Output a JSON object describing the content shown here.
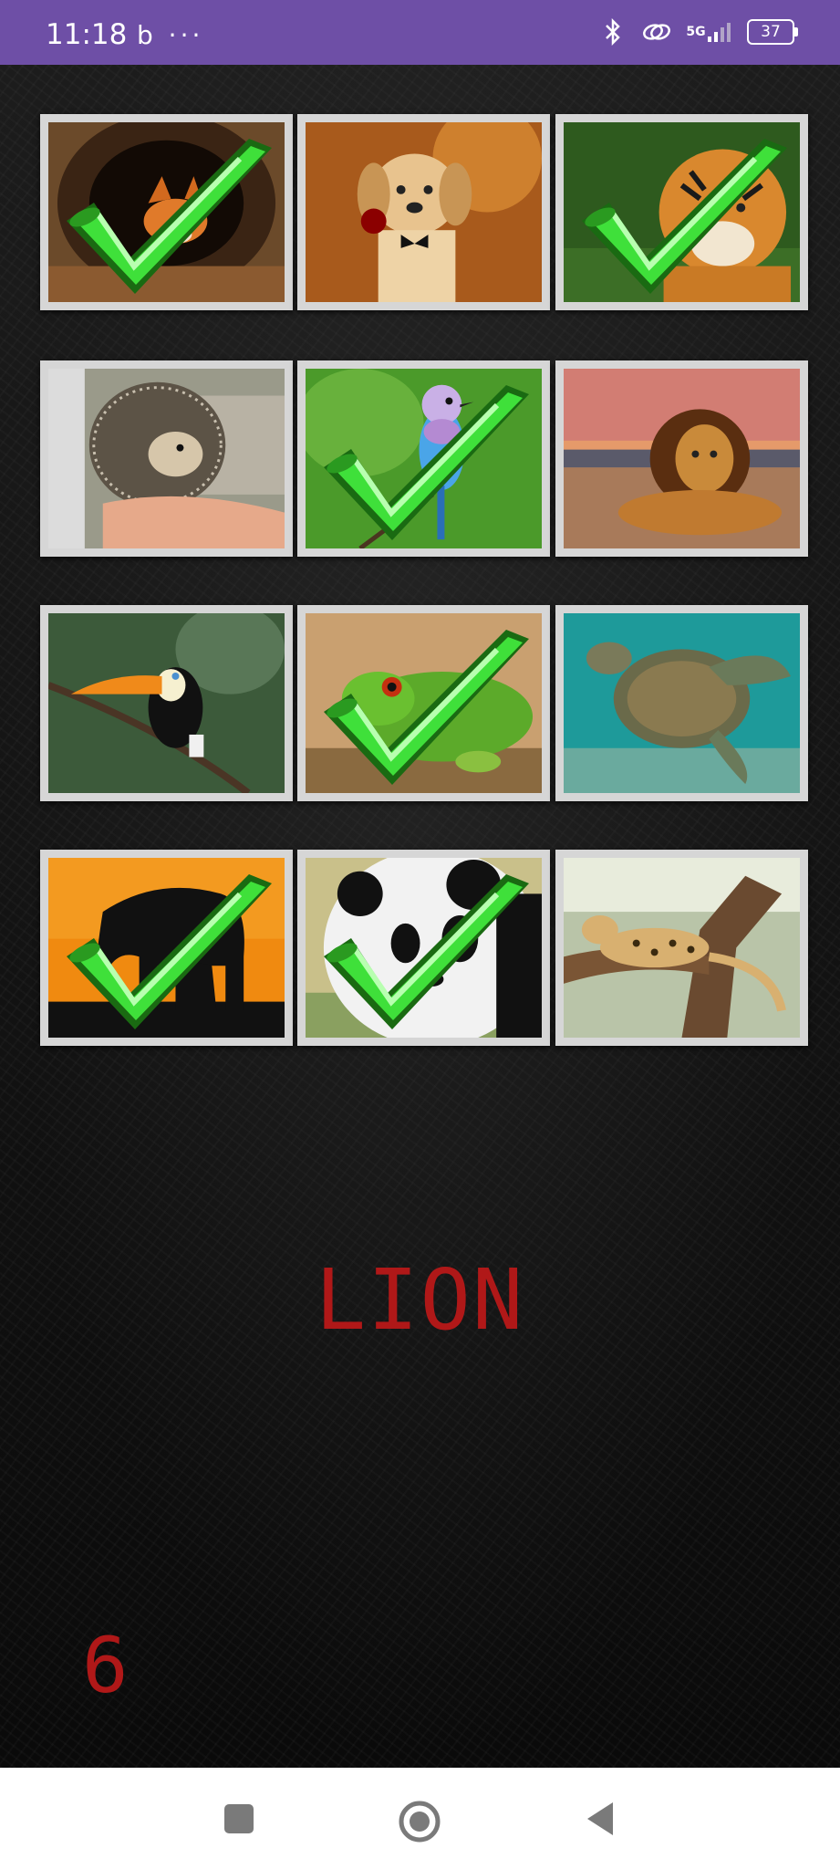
{
  "status_bar": {
    "time": "11:18",
    "left_icons": "b ···",
    "network": "5G",
    "battery": "37"
  },
  "grid": [
    {
      "name": "fox",
      "matched": true
    },
    {
      "name": "dog",
      "matched": false
    },
    {
      "name": "tiger",
      "matched": true
    },
    {
      "name": "hedgehog",
      "matched": false
    },
    {
      "name": "bird",
      "matched": true
    },
    {
      "name": "lion",
      "matched": false
    },
    {
      "name": "toucan",
      "matched": false
    },
    {
      "name": "gecko",
      "matched": true
    },
    {
      "name": "turtle",
      "matched": false
    },
    {
      "name": "elephant",
      "matched": true
    },
    {
      "name": "panda",
      "matched": true
    },
    {
      "name": "leopard",
      "matched": false
    }
  ],
  "target_word": "LION",
  "score": "6",
  "colors": {
    "status_bar": "#6e4fa6",
    "text_red": "#b01818",
    "check_green": "#3fe03a",
    "frame": "#d6d6d6"
  },
  "nav": {
    "recent": "square-icon",
    "home": "circle-icon",
    "back": "triangle-back-icon"
  }
}
